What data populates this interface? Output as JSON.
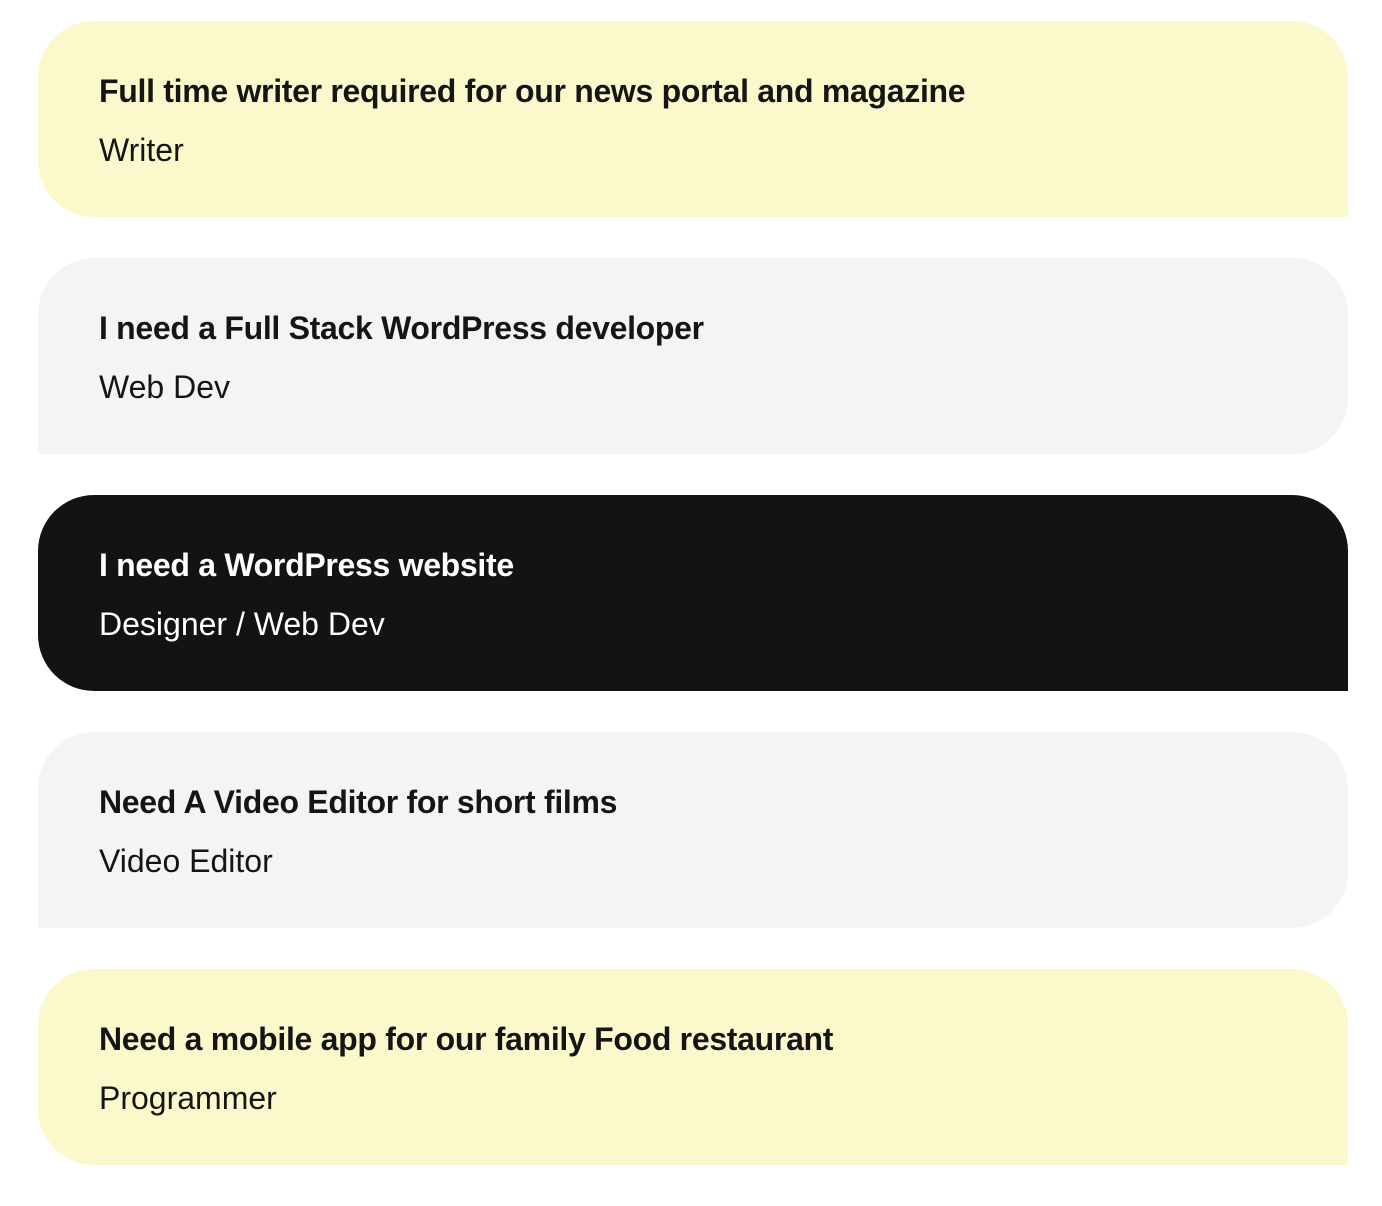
{
  "jobs": [
    {
      "title": "Full time writer required for our news portal and magazine",
      "category": "Writer",
      "theme": "yellow"
    },
    {
      "title": "I need a Full Stack WordPress developer",
      "category": "Web Dev",
      "theme": "gray"
    },
    {
      "title": "I need a WordPress website",
      "category": "Designer / Web Dev",
      "theme": "dark"
    },
    {
      "title": "Need A Video Editor for short films",
      "category": "Video Editor",
      "theme": "gray"
    },
    {
      "title": "Need a mobile app for our family Food restaurant",
      "category": "Programmer",
      "theme": "yellow"
    }
  ],
  "colors": {
    "yellow": "#fbf9cc",
    "gray": "#f4f4f4",
    "dark": "#131313",
    "text_dark": "#151515",
    "text_light": "#ffffff"
  }
}
